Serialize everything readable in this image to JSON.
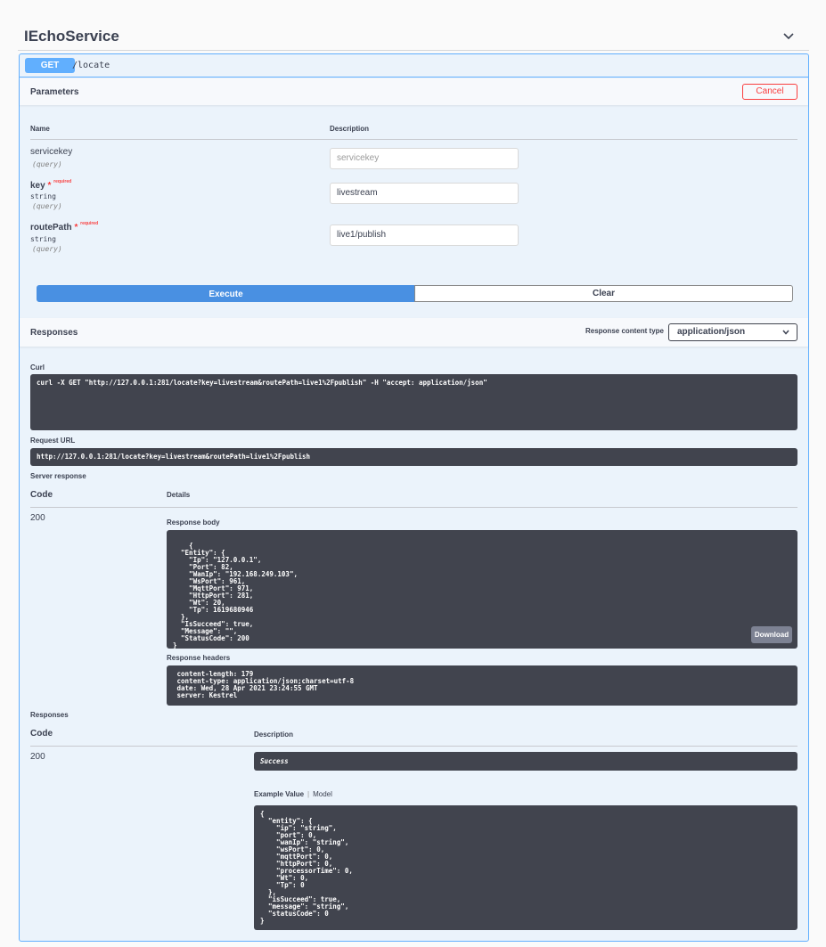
{
  "tag": {
    "title": "IEchoService"
  },
  "operation": {
    "method": "GET",
    "path": "/locate"
  },
  "parameters": {
    "title": "Parameters",
    "cancel_label": "Cancel",
    "col_name": "Name",
    "col_description": "Description",
    "required_label": "required",
    "required_star": "*",
    "items": [
      {
        "name": "servicekey",
        "type": "",
        "in": "(query)",
        "required": false,
        "value": "",
        "placeholder": "servicekey"
      },
      {
        "name": "key",
        "type": "string",
        "in": "(query)",
        "required": true,
        "value": "livestream",
        "placeholder": ""
      },
      {
        "name": "routePath",
        "type": "string",
        "in": "(query)",
        "required": true,
        "value": "live1/publish",
        "placeholder": ""
      }
    ],
    "execute_label": "Execute",
    "clear_label": "Clear"
  },
  "responses_header": {
    "title": "Responses",
    "content_type_label": "Response content type",
    "content_type_value": "application/json"
  },
  "curl": {
    "label": "Curl",
    "command": "curl -X GET \"http://127.0.0.1:281/locate?key=livestream&routePath=live1%2Fpublish\" -H \"accept: application/json\""
  },
  "request_url": {
    "label": "Request URL",
    "value": "http://127.0.0.1:281/locate?key=livestream&routePath=live1%2Fpublish"
  },
  "server_response": {
    "label": "Server response",
    "col_code": "Code",
    "col_details": "Details",
    "code": "200",
    "body_label": "Response body",
    "body": "{\n  \"Entity\": {\n    \"Ip\": \"127.0.0.1\",\n    \"Port\": 82,\n    \"WanIp\": \"192.168.249.103\",\n    \"WsPort\": 961,\n    \"MqttPort\": 971,\n    \"HttpPort\": 281,\n    \"Wt\": 20,\n    \"Tp\": 1619680946\n  },\n  \"IsSucceed\": true,\n  \"Message\": \"\",\n  \"StatusCode\": 200\n}",
    "download_label": "Download",
    "headers_label": "Response headers",
    "headers": " content-length: 179 \n content-type: application/json;charset=utf-8 \n date: Wed, 28 Apr 2021 23:24:55 GMT \n server: Kestrel "
  },
  "responses": {
    "label": "Responses",
    "col_code": "Code",
    "col_description": "Description",
    "code": "200",
    "description": "Success",
    "tab_example": "Example Value",
    "tab_model": "Model",
    "example": "{\n  \"entity\": {\n    \"ip\": \"string\",\n    \"port\": 0,\n    \"wanIp\": \"string\",\n    \"wsPort\": 0,\n    \"mqttPort\": 0,\n    \"httpPort\": 0,\n    \"processorTime\": 0,\n    \"Wt\": 0,\n    \"Tp\": 0\n  },\n  \"isSucceed\": true,\n  \"message\": \"string\",\n  \"statusCode\": 0\n}"
  }
}
